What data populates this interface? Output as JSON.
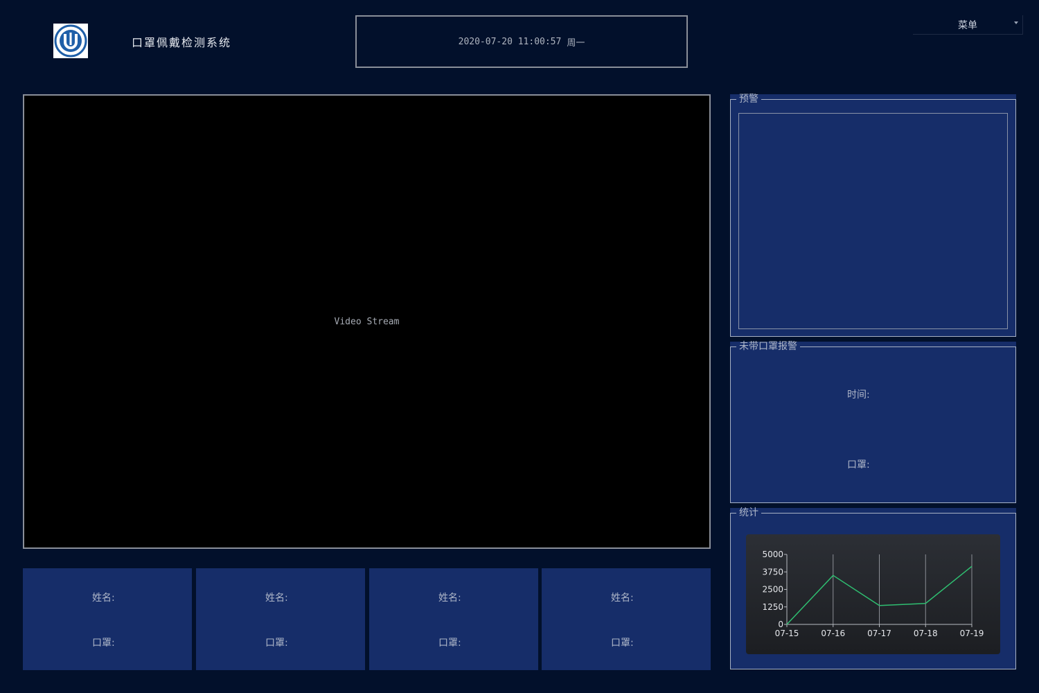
{
  "header": {
    "title": "口罩佩戴检测系统",
    "datetime": "2020-07-20 11:00:57",
    "weekday": "周一",
    "menu_label": "菜单"
  },
  "video": {
    "placeholder": "Video Stream"
  },
  "person_cards": [
    {
      "name_label": "姓名:",
      "mask_label": "口罩:"
    },
    {
      "name_label": "姓名:",
      "mask_label": "口罩:"
    },
    {
      "name_label": "姓名:",
      "mask_label": "口罩:"
    },
    {
      "name_label": "姓名:",
      "mask_label": "口罩:"
    }
  ],
  "panels": {
    "warning": {
      "title": "预警"
    },
    "no_mask_alarm": {
      "title": "未带口罩报警",
      "time_label": "时间:",
      "mask_label": "口罩:"
    },
    "stats": {
      "title": "统计"
    }
  },
  "chart_data": {
    "type": "line",
    "categories": [
      "07-15",
      "07-16",
      "07-17",
      "07-18",
      "07-19"
    ],
    "series": [
      {
        "values": [
          0,
          3500,
          1350,
          1500,
          4150
        ]
      }
    ],
    "yticks": [
      "0",
      "1250",
      "2500",
      "3750",
      "5000"
    ],
    "ylim": [
      0,
      5000
    ],
    "grid": "vertical",
    "line_color": "#2fbf71"
  }
}
